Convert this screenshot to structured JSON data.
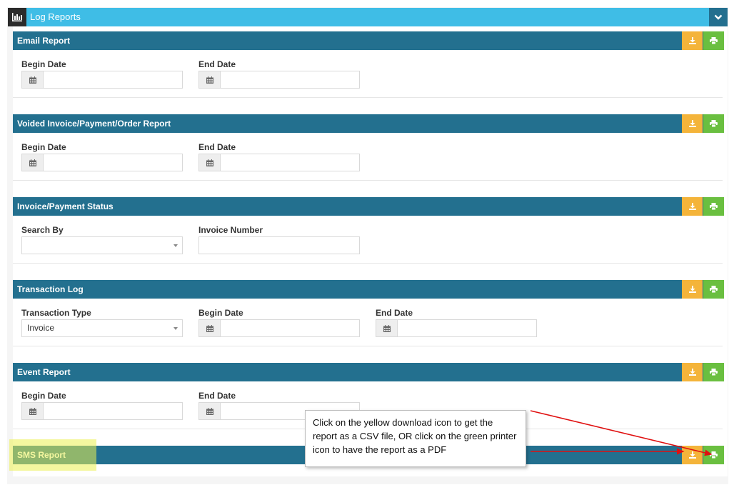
{
  "panel": {
    "title": "Log Reports",
    "icon": "bar-chart-icon",
    "collapse_icon": "chevron-down-icon"
  },
  "sections": [
    {
      "title": "Email Report",
      "fields": [
        {
          "label": "Begin Date",
          "type": "date",
          "value": ""
        },
        {
          "label": "End Date",
          "type": "date",
          "value": ""
        }
      ]
    },
    {
      "title": "Voided Invoice/Payment/Order Report",
      "fields": [
        {
          "label": "Begin Date",
          "type": "date",
          "value": ""
        },
        {
          "label": "End Date",
          "type": "date",
          "value": ""
        }
      ]
    },
    {
      "title": "Invoice/Payment Status",
      "fields": [
        {
          "label": "Search By",
          "type": "select",
          "value": ""
        },
        {
          "label": "Invoice Number",
          "type": "text",
          "value": ""
        }
      ]
    },
    {
      "title": "Transaction Log",
      "fields": [
        {
          "label": "Transaction Type",
          "type": "select",
          "value": "Invoice"
        },
        {
          "label": "Begin Date",
          "type": "date",
          "value": ""
        },
        {
          "label": "End Date",
          "type": "date",
          "value": ""
        }
      ]
    },
    {
      "title": "Event Report",
      "fields": [
        {
          "label": "Begin Date",
          "type": "date",
          "value": ""
        },
        {
          "label": "End Date",
          "type": "date",
          "value": ""
        }
      ]
    },
    {
      "title": "SMS Report",
      "fields": []
    }
  ],
  "callout": {
    "text": "Click on the yellow download icon to get the report as a CSV file, OR click on the green printer icon to have the report as a PDF"
  },
  "colors": {
    "header": "#3fbde6",
    "section_bar": "#23708f",
    "download": "#f4b43a",
    "print": "#6abf40",
    "highlight": "#ebf050",
    "arrow": "#e01010"
  }
}
